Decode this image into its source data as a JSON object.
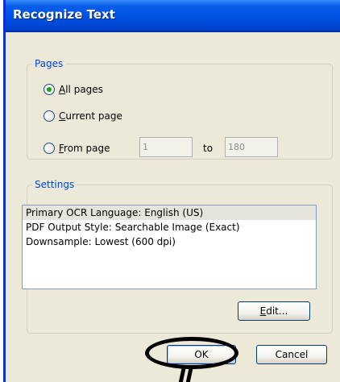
{
  "window": {
    "title": "Recognize Text"
  },
  "pages": {
    "legend": "Pages",
    "options": [
      {
        "label_key": "A",
        "label_rest": "ll pages",
        "checked": true
      },
      {
        "label_key": "C",
        "label_rest": "urrent page",
        "checked": false
      },
      {
        "label_key": "F",
        "label_rest": "rom page",
        "checked": false
      }
    ],
    "from_value": "1",
    "to_label": "to",
    "to_value": "180"
  },
  "settings": {
    "legend": "Settings",
    "items": [
      "Primary OCR Language: English (US)",
      "PDF Output Style: Searchable Image (Exact)",
      "Downsample: Lowest (600 dpi)"
    ],
    "edit_key": "E",
    "edit_rest": "dit..."
  },
  "buttons": {
    "ok": "OK",
    "cancel": "Cancel"
  },
  "colors": {
    "title_bar": "#0055e5",
    "group_label": "#0046d5",
    "dialog_bg": "#ece9d8",
    "radio_dot": "#21a121"
  }
}
